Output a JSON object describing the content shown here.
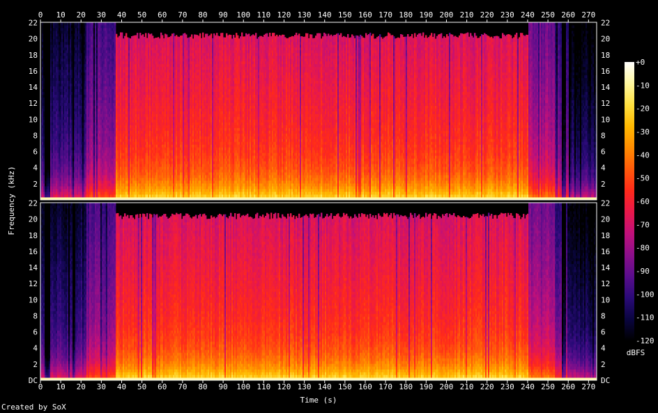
{
  "chart_data": {
    "type": "heatmap",
    "subtype": "spectrogram",
    "xlabel": "Time (s)",
    "ylabel": "Frequency (kHz)",
    "colorbar_label": "dBFS",
    "x_ticks": [
      0,
      10,
      20,
      30,
      40,
      50,
      60,
      70,
      80,
      90,
      100,
      110,
      120,
      130,
      140,
      150,
      160,
      170,
      180,
      190,
      200,
      210,
      220,
      230,
      240,
      250,
      260,
      270
    ],
    "xlim": [
      0,
      274
    ],
    "y_ticks_upper": [
      "22",
      "20",
      "18",
      "16",
      "14",
      "12",
      "10",
      "8",
      "6",
      "4",
      "2"
    ],
    "y_ticks_lower": [
      "22",
      "20",
      "18",
      "16",
      "14",
      "12",
      "10",
      "8",
      "6",
      "4",
      "2",
      "DC"
    ],
    "ylim_khz": [
      0,
      22.05
    ],
    "colorbar_ticks": [
      "+0",
      "-10",
      "-20",
      "-30",
      "-40",
      "-50",
      "-60",
      "-70",
      "-80",
      "-90",
      "-100",
      "-110",
      "-120"
    ],
    "color_range_dbfs": [
      -120,
      0
    ],
    "channels": [
      {
        "segments": [
          {
            "t": [
              0,
              2
            ],
            "level": -100
          },
          {
            "t": [
              2,
              22
            ],
            "level": -95
          },
          {
            "t": [
              22,
              37
            ],
            "level": -78
          },
          {
            "t": [
              37,
              240
            ],
            "level": -50
          },
          {
            "t": [
              240,
              253
            ],
            "level": -70
          },
          {
            "t": [
              253,
              260
            ],
            "level": -82
          },
          {
            "t": [
              260,
              274
            ],
            "level": -102
          }
        ],
        "bandlimit_khz": 20,
        "quiet_gaps_s": [
          [
            2,
            4.5
          ],
          [
            256.5,
            258.5
          ]
        ]
      },
      {
        "segments": [
          {
            "t": [
              0,
              2
            ],
            "level": -100
          },
          {
            "t": [
              2,
              22
            ],
            "level": -95
          },
          {
            "t": [
              22,
              37
            ],
            "level": -78
          },
          {
            "t": [
              37,
              240
            ],
            "level": -50
          },
          {
            "t": [
              240,
              253
            ],
            "level": -70
          },
          {
            "t": [
              253,
              260
            ],
            "level": -82
          },
          {
            "t": [
              260,
              274
            ],
            "level": -102
          }
        ],
        "bandlimit_khz": 20,
        "quiet_gaps_s": [
          [
            2,
            4.5
          ],
          [
            256.5,
            258.5
          ]
        ]
      }
    ],
    "palette": [
      "#000000",
      "#0a0540",
      "#2a0a78",
      "#5a0d8c",
      "#8c0f8a",
      "#c0107a",
      "#e8184a",
      "#ff2a1a",
      "#ff5a0a",
      "#ff8c00",
      "#ffb800",
      "#ffe040",
      "#fff8a0",
      "#ffffff"
    ]
  },
  "footer": {
    "credit": "Created by SoX"
  }
}
